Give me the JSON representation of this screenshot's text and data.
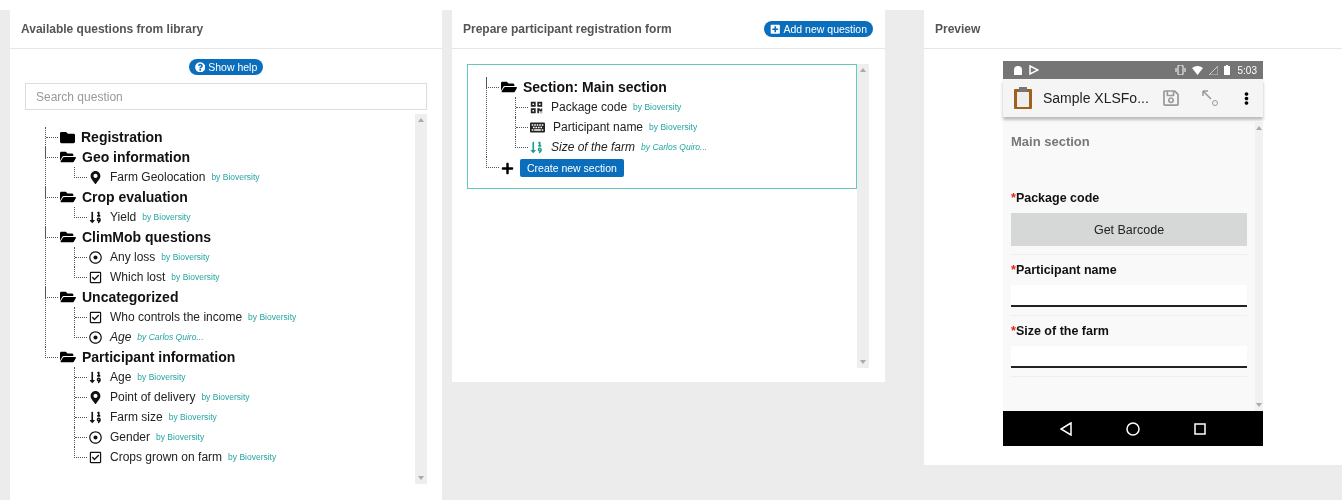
{
  "library": {
    "title": "Available questions from library",
    "help_button": "Show help",
    "search": {
      "placeholder": "Search question"
    },
    "tree": [
      {
        "label": "Registration",
        "expanded": false
      },
      {
        "label": "Geo information",
        "expanded": true,
        "children": [
          {
            "label": "Farm Geolocation",
            "by": "by Bioversity",
            "kind": "location",
            "italic": false
          }
        ]
      },
      {
        "label": "Crop evaluation",
        "expanded": true,
        "children": [
          {
            "label": "Yield",
            "by": "by Bioversity",
            "kind": "number",
            "italic": false
          }
        ]
      },
      {
        "label": "ClimMob questions",
        "expanded": true,
        "children": [
          {
            "label": "Any loss",
            "by": "by Bioversity",
            "kind": "radio",
            "italic": false
          },
          {
            "label": "Which lost",
            "by": "by Bioversity",
            "kind": "checkbox",
            "italic": false
          }
        ]
      },
      {
        "label": "Uncategorized",
        "expanded": true,
        "children": [
          {
            "label": "Who controls the income",
            "by": "by Bioversity",
            "kind": "checkbox",
            "italic": false
          },
          {
            "label": "Age",
            "by": "by Carlos Quiro...",
            "kind": "radio",
            "italic": true
          }
        ]
      },
      {
        "label": "Participant information",
        "expanded": true,
        "children": [
          {
            "label": "Age",
            "by": "by Bioversity",
            "kind": "number",
            "italic": false
          },
          {
            "label": "Point of delivery",
            "by": "by Bioversity",
            "kind": "location",
            "italic": false
          },
          {
            "label": "Farm size",
            "by": "by Bioversity",
            "kind": "number",
            "italic": false
          },
          {
            "label": "Gender",
            "by": "by Bioversity",
            "kind": "radio",
            "italic": false
          },
          {
            "label": "Crops grown on farm",
            "by": "by Bioversity",
            "kind": "checkbox",
            "italic": false
          }
        ]
      }
    ]
  },
  "form": {
    "title": "Prepare participant registration form",
    "add_button": "Add new question",
    "sections": [
      {
        "label": "Section: Main section",
        "expanded": true,
        "children": [
          {
            "label": "Package code",
            "by": "by Bioversity",
            "kind": "barcode",
            "italic": false,
            "color": "#222222"
          },
          {
            "label": "Participant name",
            "by": "by Bioversity",
            "kind": "keyboard",
            "italic": false,
            "color": "#222222"
          },
          {
            "label": "Size of the farm",
            "by": "by Carlos Quiro...",
            "kind": "number",
            "italic": true,
            "color": "#1a9e8f"
          }
        ]
      }
    ],
    "create_button": "Create new section"
  },
  "preview": {
    "title": "Preview",
    "phone": {
      "time": "5:03",
      "app_title": "Sample XLSFo...",
      "section": "Main section",
      "fields": [
        {
          "kind": "barcode",
          "marker": "*",
          "label": "Package code",
          "button": "Get Barcode"
        },
        {
          "kind": "text",
          "marker": "*",
          "label": "Participant name"
        },
        {
          "kind": "text",
          "marker": "*",
          "label": "Size of the farm"
        }
      ]
    }
  }
}
